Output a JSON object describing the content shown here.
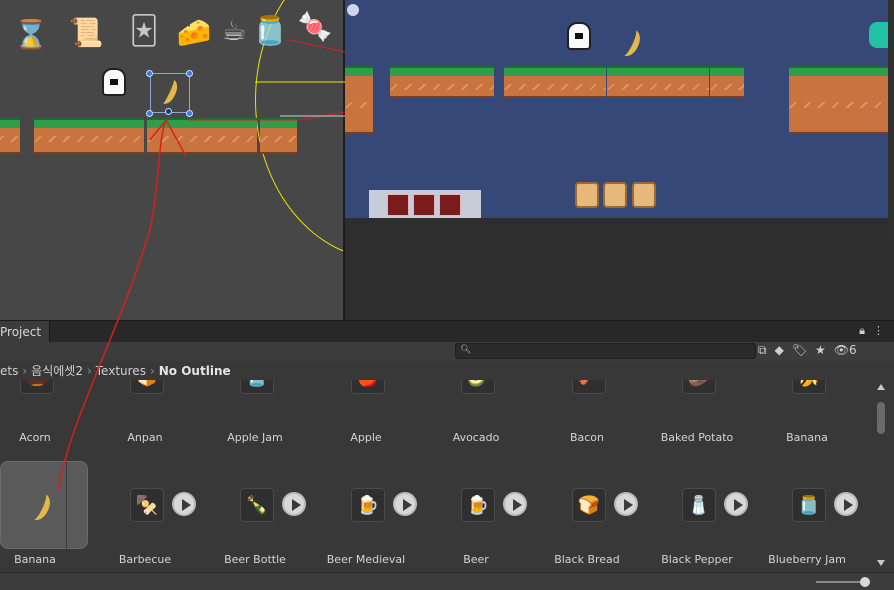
{
  "project_tab": {
    "label": "Project",
    "lock_icon": "lock-icon",
    "menu_icon": "kebab-menu-icon"
  },
  "toolbar": {
    "hidden_count": "6"
  },
  "breadcrumb": {
    "items": [
      "ets",
      "음식에셋2",
      "Textures"
    ],
    "current": "No Outline"
  },
  "grid": {
    "row1": [
      {
        "label": "Acorn",
        "glyph": "🌰"
      },
      {
        "label": "Anpan",
        "glyph": "🍞"
      },
      {
        "label": "Apple Jam",
        "glyph": "🫙"
      },
      {
        "label": "Apple",
        "glyph": "🍎"
      },
      {
        "label": "Avocado",
        "glyph": "🥑"
      },
      {
        "label": "Bacon",
        "glyph": "🥓"
      },
      {
        "label": "Baked Potato",
        "glyph": "🥔"
      },
      {
        "label": "Banana",
        "glyph": "🍌"
      }
    ],
    "row2": [
      {
        "label": "Banana",
        "glyph": "🍌"
      },
      {
        "label": "Barbecue",
        "glyph": "🍢"
      },
      {
        "label": "Beer Bottle",
        "glyph": "🍾"
      },
      {
        "label": "Beer Medieval",
        "glyph": "🍺"
      },
      {
        "label": "Beer",
        "glyph": "🍺"
      },
      {
        "label": "Black Bread",
        "glyph": "🍞"
      },
      {
        "label": "Black Pepper",
        "glyph": "🧂"
      },
      {
        "label": "Blueberry Jam",
        "glyph": "🫙"
      }
    ]
  },
  "scene": {
    "toolbar_items": [
      "hourglass",
      "scroll",
      "cards",
      "cheese",
      "coffee",
      "jar",
      "candy"
    ]
  },
  "colors": {
    "accent": "#3a7ae8",
    "grass": "#2f9e4a",
    "dirt": "#c9733e",
    "game_bg": "#354878"
  }
}
